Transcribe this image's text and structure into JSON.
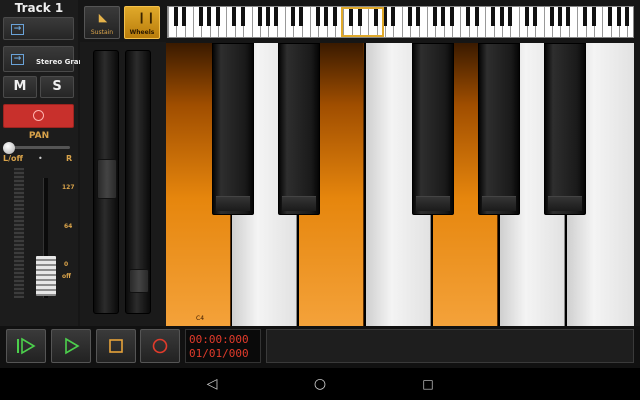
{
  "track": {
    "title": "Track 1",
    "input_label": "",
    "output_label": "Stereo Gran",
    "mute_label": "M",
    "solo_label": "S"
  },
  "pan": {
    "label": "PAN",
    "left_label": "L/off",
    "center_mark": "•",
    "right_label": "R",
    "value": 0
  },
  "volume": {
    "scale": [
      "127",
      "64",
      "0",
      "off"
    ],
    "level": 0.2
  },
  "toolbar": {
    "sustain_label": "Sustain",
    "wheels_label": "Wheels",
    "wheels_active": true
  },
  "keyboard": {
    "active_keys": [
      "C4",
      "E4",
      "G4"
    ],
    "c_label": "C4"
  },
  "transport": {
    "time": "00:00:000",
    "position": "01/01/000"
  },
  "icons": {
    "loop_play": "loop-play-icon",
    "play": "play-icon",
    "stop": "stop-icon",
    "record": "record-icon"
  },
  "colors": {
    "accent": "#e0a92a",
    "record": "#c8302c",
    "time_text": "#e23b2b",
    "play_green": "#4cd04c",
    "stop_orange": "#e6a23a"
  }
}
